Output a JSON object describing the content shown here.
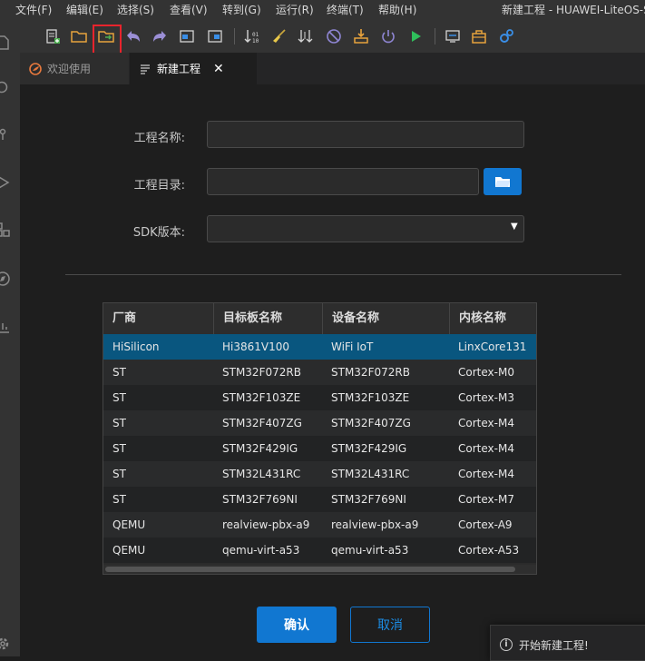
{
  "menubar": {
    "items": [
      "文件(F)",
      "编辑(E)",
      "选择(S)",
      "查看(V)",
      "转到(G)",
      "运行(R)",
      "终端(T)",
      "帮助(H)"
    ],
    "window_title": "新建工程 - HUAWEI-LiteOS-St"
  },
  "toolbar": {
    "icons": [
      "new-file-icon",
      "open-folder-icon",
      "new-project-icon",
      "undo-icon",
      "redo-icon",
      "import-icon",
      "export-icon",
      "compile-icon",
      "clean-icon",
      "rebuild-icon",
      "stop-icon",
      "burn-icon",
      "power-icon",
      "run-icon",
      "serial-monitor-icon",
      "toolbox-icon",
      "settings-gear-icon"
    ]
  },
  "tabs": [
    {
      "label": "欢迎使用",
      "active": false
    },
    {
      "label": "新建工程",
      "active": true,
      "close": "✕"
    }
  ],
  "form": {
    "project_name_label": "工程名称:",
    "project_name_value": "",
    "project_dir_label": "工程目录:",
    "project_dir_value": "",
    "sdk_label": "SDK版本:",
    "sdk_value": ""
  },
  "table": {
    "headers": [
      "厂商",
      "目标板名称",
      "设备名称",
      "内核名称"
    ],
    "rows": [
      [
        "HiSilicon",
        "Hi3861V100",
        "WiFi IoT",
        "LinxCore131"
      ],
      [
        "ST",
        "STM32F072RB",
        "STM32F072RB",
        "Cortex-M0"
      ],
      [
        "ST",
        "STM32F103ZE",
        "STM32F103ZE",
        "Cortex-M3"
      ],
      [
        "ST",
        "STM32F407ZG",
        "STM32F407ZG",
        "Cortex-M4"
      ],
      [
        "ST",
        "STM32F429IG",
        "STM32F429IG",
        "Cortex-M4"
      ],
      [
        "ST",
        "STM32L431RC",
        "STM32L431RC",
        "Cortex-M4"
      ],
      [
        "ST",
        "STM32F769NI",
        "STM32F769NI",
        "Cortex-M7"
      ],
      [
        "QEMU",
        "realview-pbx-a9",
        "realview-pbx-a9",
        "Cortex-A9"
      ],
      [
        "QEMU",
        "qemu-virt-a53",
        "qemu-virt-a53",
        "Cortex-A53"
      ]
    ],
    "selected_row": 0
  },
  "buttons": {
    "confirm": "确认",
    "cancel": "取消"
  },
  "notification": {
    "icon": "info-icon",
    "text": "开始新建工程!"
  },
  "colors": {
    "accent": "#1177d1",
    "selection": "#09567f",
    "highlight": "#e8242d"
  }
}
